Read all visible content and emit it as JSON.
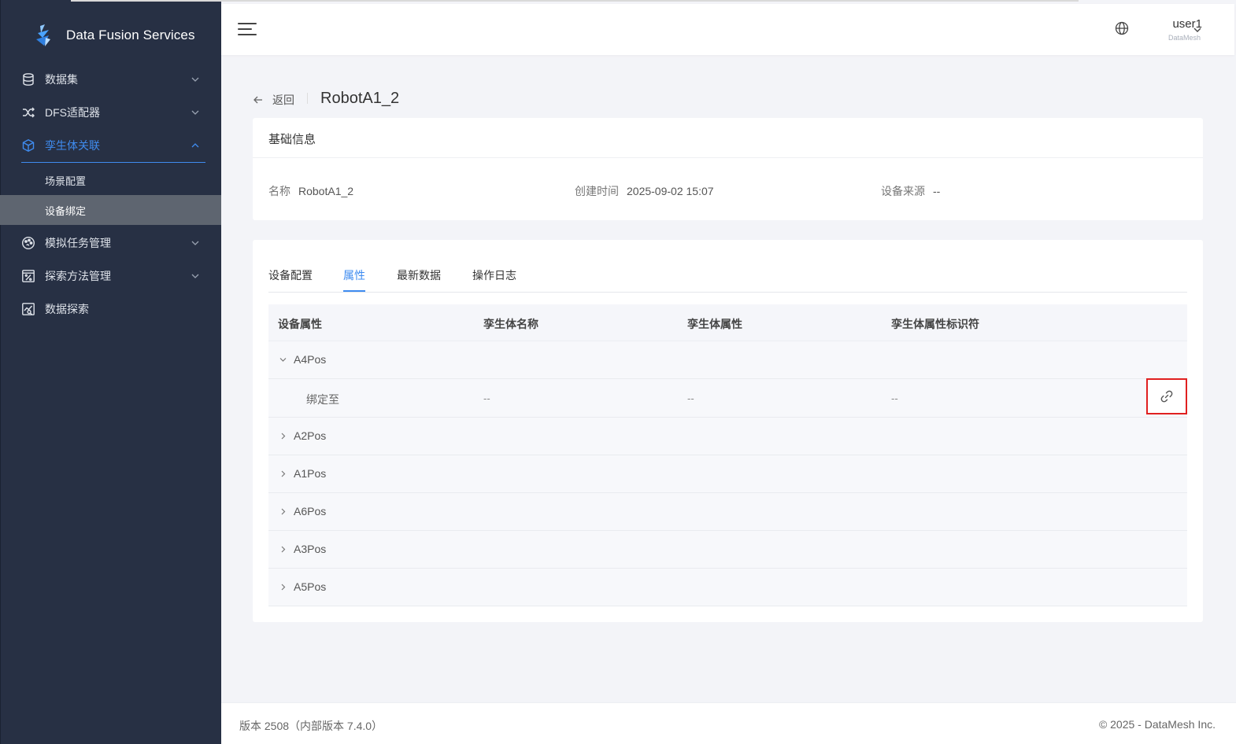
{
  "app": {
    "name": "Data Fusion Services"
  },
  "sidebar": {
    "items": [
      {
        "label": "数据集",
        "icon": "database-icon"
      },
      {
        "label": "DFS适配器",
        "icon": "shuffle-icon"
      },
      {
        "label": "孪生体关联",
        "icon": "cube-icon",
        "expanded": true,
        "children": [
          {
            "label": "场景配置"
          },
          {
            "label": "设备绑定",
            "selected": true
          }
        ]
      },
      {
        "label": "模拟任务管理",
        "icon": "palette-icon"
      },
      {
        "label": "探索方法管理",
        "icon": "percent-calculator-icon"
      },
      {
        "label": "数据探索",
        "icon": "chart-search-icon"
      }
    ]
  },
  "header": {
    "username": "user1",
    "org": "DataMesh"
  },
  "page": {
    "back_label": "返回",
    "title": "RobotA1_2"
  },
  "basic_info": {
    "title": "基础信息",
    "fields": [
      {
        "label": "名称",
        "value": "RobotA1_2"
      },
      {
        "label": "创建时间",
        "value": "2025-09-02 15:07"
      },
      {
        "label": "设备来源",
        "value": "--"
      }
    ]
  },
  "tabs": [
    {
      "label": "设备配置"
    },
    {
      "label": "属性",
      "active": true
    },
    {
      "label": "最新数据"
    },
    {
      "label": "操作日志"
    }
  ],
  "table": {
    "columns": [
      "设备属性",
      "孪生体名称",
      "孪生体属性",
      "孪生体属性标识符"
    ],
    "rows": [
      {
        "name": "A4Pos",
        "expanded": true,
        "child": {
          "label": "绑定至",
          "twin_name": "--",
          "twin_attr": "--",
          "twin_attr_id": "--"
        }
      },
      {
        "name": "A2Pos"
      },
      {
        "name": "A1Pos"
      },
      {
        "name": "A6Pos"
      },
      {
        "name": "A3Pos"
      },
      {
        "name": "A5Pos"
      }
    ]
  },
  "footer": {
    "version": "版本 2508（内部版本 7.4.0）",
    "copyright": "© 2025 - DataMesh Inc."
  },
  "colors": {
    "sidebar_bg": "#273044",
    "accent": "#3f8cf0",
    "highlight_border": "#e02020"
  }
}
